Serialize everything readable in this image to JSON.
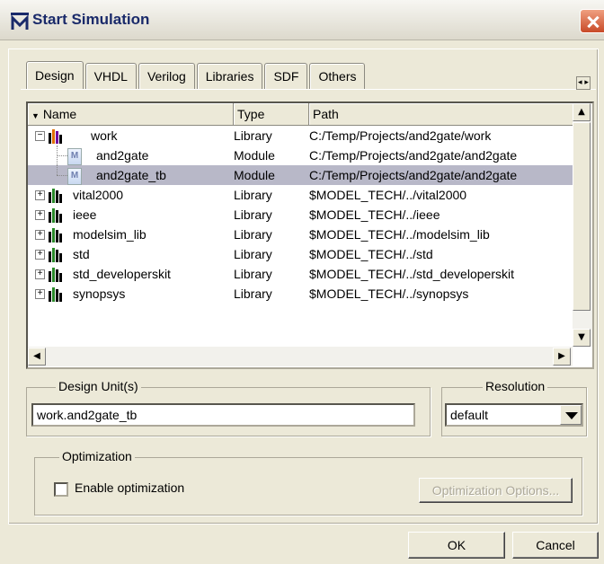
{
  "window": {
    "title": "Start Simulation"
  },
  "tabs": [
    {
      "label": "Design"
    },
    {
      "label": "VHDL"
    },
    {
      "label": "Verilog"
    },
    {
      "label": "Libraries"
    },
    {
      "label": "SDF"
    },
    {
      "label": "Others"
    }
  ],
  "tab_scroll_label": "◂ ▸",
  "columns": {
    "name": "Name",
    "type": "Type",
    "path": "Path"
  },
  "rows": [
    {
      "name": "work",
      "type": "Library",
      "path": "C:/Temp/Projects/and2gate/work"
    },
    {
      "name": "and2gate",
      "type": "Module",
      "path": "C:/Temp/Projects/and2gate/and2gate"
    },
    {
      "name": "and2gate_tb",
      "type": "Module",
      "path": "C:/Temp/Projects/and2gate/and2gate"
    },
    {
      "name": "vital2000",
      "type": "Library",
      "path": "$MODEL_TECH/../vital2000"
    },
    {
      "name": "ieee",
      "type": "Library",
      "path": "$MODEL_TECH/../ieee"
    },
    {
      "name": "modelsim_lib",
      "type": "Library",
      "path": "$MODEL_TECH/../modelsim_lib"
    },
    {
      "name": "std",
      "type": "Library",
      "path": "$MODEL_TECH/../std"
    },
    {
      "name": "std_developerskit",
      "type": "Library",
      "path": "$MODEL_TECH/../std_developerskit"
    },
    {
      "name": "synopsys",
      "type": "Library",
      "path": "$MODEL_TECH/../synopsys"
    }
  ],
  "design_units": {
    "label": "Design Unit(s)",
    "value": "work.and2gate_tb"
  },
  "resolution": {
    "label": "Resolution",
    "value": "default"
  },
  "optimization": {
    "label": "Optimization",
    "checkbox_label": "Enable optimization",
    "checked": false,
    "options_button": "Optimization Options..."
  },
  "buttons": {
    "ok": "OK",
    "cancel": "Cancel"
  },
  "colors": {
    "selected_row": "#b8b8c8",
    "title_text": "#1a2a6a",
    "dialog_bg": "#ece9d8"
  }
}
